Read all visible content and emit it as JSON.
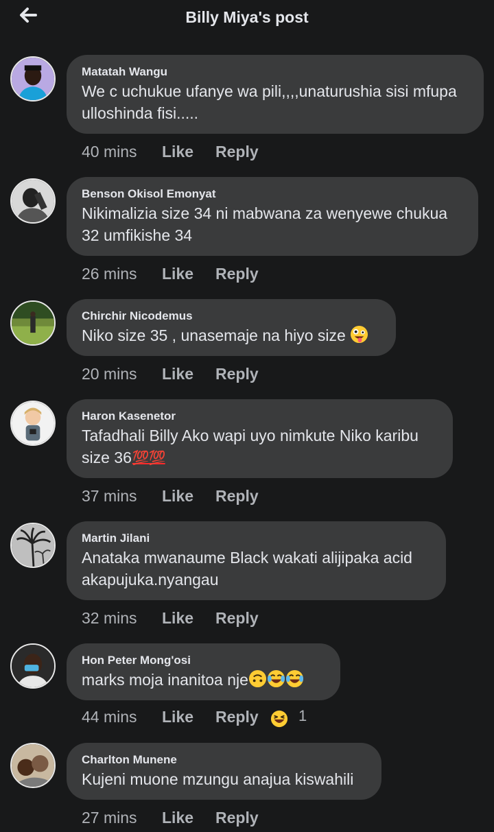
{
  "header": {
    "title": "Billy Miya's post",
    "back_icon": "arrow-left-icon"
  },
  "comments": [
    {
      "author": "Matatah Wangu",
      "lines": [
        "We c uchukue ufanye wa pili,,,,unaturushia sisi mfupa",
        "ulloshinda fisi....."
      ],
      "time": "40 mins",
      "like": "Like",
      "reply": "Reply"
    },
    {
      "author": "Benson Okisol Emonyat",
      "lines": [
        "Nikimalizia size 34 ni mabwana za wenyewe chukua",
        "32 umfikishe 34"
      ],
      "time": "26 mins",
      "like": "Like",
      "reply": "Reply"
    },
    {
      "author": "Chirchir Nicodemus",
      "lines": [
        "Niko size 35 , unasemaje na hiyo size"
      ],
      "emoji": "zany-face-emoji",
      "time": "20 mins",
      "like": "Like",
      "reply": "Reply"
    },
    {
      "author": "Haron Kasenetor",
      "lines": [
        "Tafadhali Billy Ako wapi uyo nimkute Niko karibu",
        "size 36"
      ],
      "emoji_text": "💯💯",
      "time": "37 mins",
      "like": "Like",
      "reply": "Reply"
    },
    {
      "author": "Martin Jilani",
      "lines": [
        "Anataka mwanaume Black wakati alijipaka acid",
        "akapujuka.nyangau"
      ],
      "time": "32 mins",
      "like": "Like",
      "reply": "Reply"
    },
    {
      "author": "Hon Peter Mong'osi",
      "lines": [
        "marks moja inanitoa nje"
      ],
      "emoji": "upside-down-face-emoji, tears-of-joy-emoji, tears-of-joy-emoji",
      "time": "44 mins",
      "like": "Like",
      "reply": "Reply",
      "reaction": "haha-reaction-icon",
      "reaction_count": "1"
    },
    {
      "author": "Charlton Munene",
      "lines": [
        "Kujeni muone mzungu anajua kiswahili"
      ],
      "time": "27 mins",
      "like": "Like",
      "reply": "Reply"
    }
  ],
  "colors": {
    "background": "#18191a",
    "bubble": "#3a3b3c",
    "text": "#e4e6eb",
    "meta": "#b0b3b8"
  }
}
